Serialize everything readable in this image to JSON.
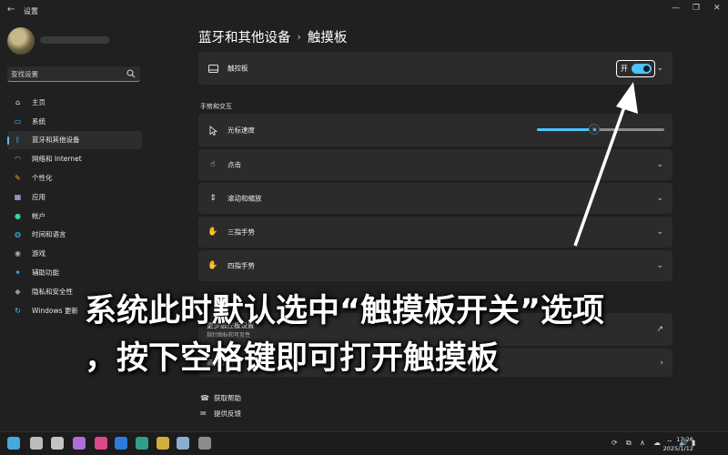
{
  "window": {
    "title": "设置",
    "back_glyph": "←",
    "minimize_glyph": "—",
    "maximize_glyph": "❐",
    "close_glyph": "✕"
  },
  "search": {
    "placeholder": "查找设置",
    "icon": "search-icon"
  },
  "sidebar": {
    "items": [
      {
        "label": "主页",
        "icon": "home-icon",
        "glyph": "⌂",
        "color": "#e8e8e8"
      },
      {
        "label": "系统",
        "icon": "monitor-icon",
        "glyph": "▭",
        "color": "#4cc2ff"
      },
      {
        "label": "蓝牙和其他设备",
        "icon": "bluetooth-icon",
        "glyph": "ᛒ",
        "color": "#4cc2ff",
        "active": true
      },
      {
        "label": "网络和 Internet",
        "icon": "wifi-icon",
        "glyph": "◠",
        "color": "#6fb3ff"
      },
      {
        "label": "个性化",
        "icon": "brush-icon",
        "glyph": "✎",
        "color": "#f0a030"
      },
      {
        "label": "应用",
        "icon": "apps-icon",
        "glyph": "▦",
        "color": "#c0c0ff"
      },
      {
        "label": "帐户",
        "icon": "account-icon",
        "glyph": "●",
        "color": "#3ad19a"
      },
      {
        "label": "时间和语言",
        "icon": "globe-icon",
        "glyph": "◍",
        "color": "#4cc2ff"
      },
      {
        "label": "游戏",
        "icon": "gamepad-icon",
        "glyph": "◉",
        "color": "#b0b0b0"
      },
      {
        "label": "辅助功能",
        "icon": "accessibility-icon",
        "glyph": "✶",
        "color": "#4cc2ff"
      },
      {
        "label": "隐私和安全性",
        "icon": "shield-icon",
        "glyph": "◆",
        "color": "#9a9a9a"
      },
      {
        "label": "Windows 更新",
        "icon": "update-icon",
        "glyph": "↻",
        "color": "#4cc2ff"
      }
    ]
  },
  "main": {
    "breadcrumb_parent": "蓝牙和其他设备",
    "breadcrumb_sep": "›",
    "breadcrumb_current": "触摸板",
    "touchpad_row": {
      "label": "触控板",
      "toggle_label": "开",
      "toggle_on": true
    },
    "section_title": "手势和交互",
    "cursor_speed": {
      "label": "光标速度",
      "value_fraction": 0.45
    },
    "rows": [
      {
        "label": "点击",
        "icon": "tap-icon",
        "glyph": "☝"
      },
      {
        "label": "滚动和缩放",
        "icon": "scroll-icon",
        "glyph": "⇕"
      },
      {
        "label": "三指手势",
        "icon": "three-finger-icon",
        "glyph": "✋"
      },
      {
        "label": "四指手势",
        "icon": "four-finger-icon",
        "glyph": "✋"
      }
    ],
    "more_settings": {
      "label": "更多触控板设置",
      "sub": "指针图标和可见性",
      "icon": "external-link-icon",
      "glyph": "↗"
    },
    "advanced_gestures": {
      "label": "高级手势"
    },
    "help_links": [
      {
        "label": "获取帮助",
        "icon": "help-icon",
        "glyph": "☎"
      },
      {
        "label": "提供反馈",
        "icon": "feedback-icon",
        "glyph": "✉"
      }
    ]
  },
  "caption": {
    "line1": "系统此时默认选中“触摸板开关”选项",
    "line2": "，按下空格键即可打开触摸板"
  },
  "taskbar": {
    "apps": [
      {
        "icon": "windows-start-icon",
        "color": "#4cc2ff"
      },
      {
        "icon": "clock-app-icon",
        "color": "#d8d8d8"
      },
      {
        "icon": "calendar-icon",
        "color": "#e0e0e0"
      },
      {
        "icon": "photos-icon",
        "color": "#c77dff"
      },
      {
        "icon": "store-icon",
        "color": "#ff4fa0"
      },
      {
        "icon": "mail-icon",
        "color": "#2f8cff"
      },
      {
        "icon": "edge-icon",
        "color": "#2fb7a0"
      },
      {
        "icon": "file-explorer-icon",
        "color": "#f2c744"
      },
      {
        "icon": "notepad-icon",
        "color": "#9ec8f0"
      },
      {
        "icon": "settings-app-icon",
        "color": "#a0a0a0"
      }
    ],
    "tray_glyphs": [
      "⟳",
      "⧉",
      "∧",
      "☁",
      "⌔",
      "🔊",
      "▮"
    ],
    "time": "17:26",
    "date": "2025/1/12"
  }
}
